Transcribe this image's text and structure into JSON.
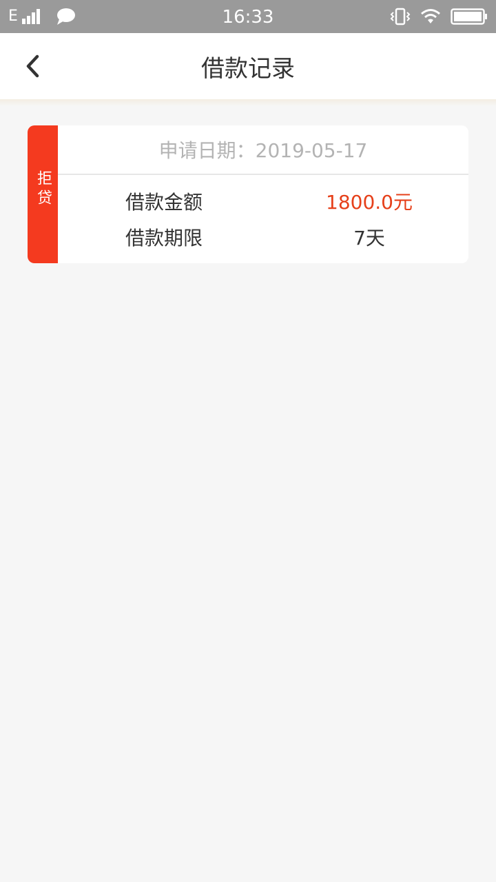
{
  "status_bar": {
    "network": "E",
    "time": "16:33",
    "icons": [
      "signal-icon",
      "message-icon",
      "vibrate-icon",
      "wifi-icon",
      "battery-icon"
    ]
  },
  "header": {
    "back_icon": "chevron-left-icon",
    "title": "借款记录"
  },
  "records": [
    {
      "status": "拒贷",
      "apply_date": "申请日期：2019-05-17",
      "amount_label": "借款金额",
      "amount_value": "1800.0元",
      "term_label": "借款期限",
      "term_value": "7天"
    }
  ],
  "colors": {
    "status_bar_bg": "#9a9a9a",
    "status_tag_bg": "#f43a1f",
    "amount_text": "#e6401a",
    "page_bg": "#f6f6f6"
  }
}
